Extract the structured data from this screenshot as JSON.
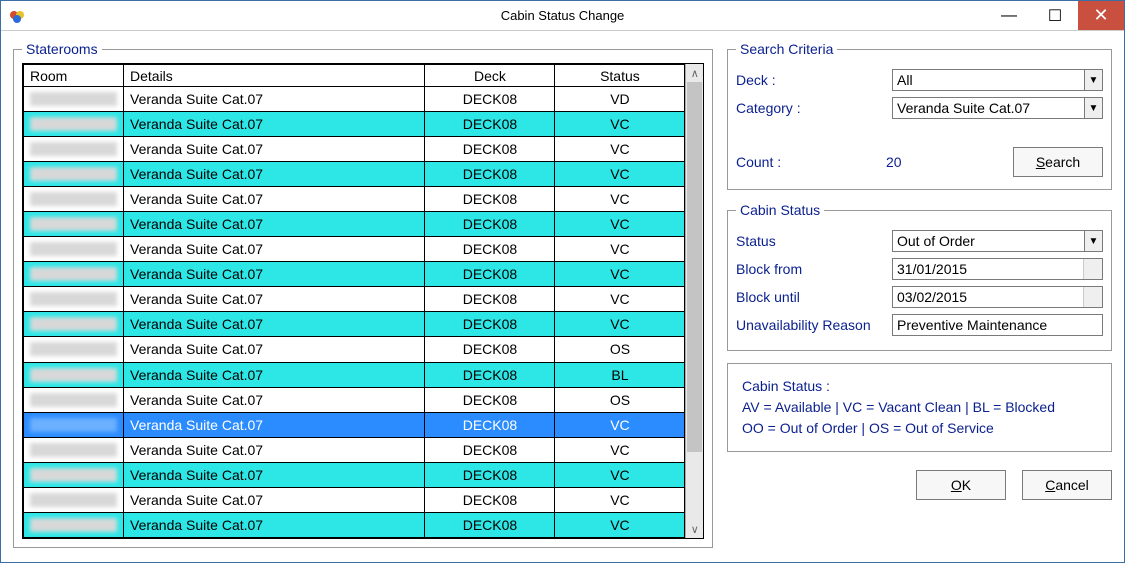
{
  "window": {
    "title": "Cabin Status Change"
  },
  "staterooms": {
    "legend": "Staterooms",
    "headers": {
      "room": "Room",
      "details": "Details",
      "deck": "Deck",
      "status": "Status"
    },
    "rows": [
      {
        "details": "Veranda Suite Cat.07",
        "deck": "DECK08",
        "status": "VD",
        "style": "white"
      },
      {
        "details": "Veranda Suite Cat.07",
        "deck": "DECK08",
        "status": "VC",
        "style": "cyan"
      },
      {
        "details": "Veranda Suite Cat.07",
        "deck": "DECK08",
        "status": "VC",
        "style": "white"
      },
      {
        "details": "Veranda Suite Cat.07",
        "deck": "DECK08",
        "status": "VC",
        "style": "cyan"
      },
      {
        "details": "Veranda Suite Cat.07",
        "deck": "DECK08",
        "status": "VC",
        "style": "white"
      },
      {
        "details": "Veranda Suite Cat.07",
        "deck": "DECK08",
        "status": "VC",
        "style": "cyan"
      },
      {
        "details": "Veranda Suite Cat.07",
        "deck": "DECK08",
        "status": "VC",
        "style": "white"
      },
      {
        "details": "Veranda Suite Cat.07",
        "deck": "DECK08",
        "status": "VC",
        "style": "cyan"
      },
      {
        "details": "Veranda Suite Cat.07",
        "deck": "DECK08",
        "status": "VC",
        "style": "white"
      },
      {
        "details": "Veranda Suite Cat.07",
        "deck": "DECK08",
        "status": "VC",
        "style": "cyan"
      },
      {
        "details": "Veranda Suite Cat.07",
        "deck": "DECK08",
        "status": "OS",
        "style": "white"
      },
      {
        "details": "Veranda Suite Cat.07",
        "deck": "DECK08",
        "status": "BL",
        "style": "cyan"
      },
      {
        "details": "Veranda Suite Cat.07",
        "deck": "DECK08",
        "status": "OS",
        "style": "white"
      },
      {
        "details": "Veranda Suite Cat.07",
        "deck": "DECK08",
        "status": "VC",
        "style": "sel"
      },
      {
        "details": "Veranda Suite Cat.07",
        "deck": "DECK08",
        "status": "VC",
        "style": "white"
      },
      {
        "details": "Veranda Suite Cat.07",
        "deck": "DECK08",
        "status": "VC",
        "style": "cyan"
      },
      {
        "details": "Veranda Suite Cat.07",
        "deck": "DECK08",
        "status": "VC",
        "style": "white"
      },
      {
        "details": "Veranda Suite Cat.07",
        "deck": "DECK08",
        "status": "VC",
        "style": "cyan"
      }
    ]
  },
  "search": {
    "legend": "Search Criteria",
    "deck_label": "Deck :",
    "deck_value": "All",
    "category_label": "Category :",
    "category_value": "Veranda Suite Cat.07",
    "count_label": "Count :",
    "count_value": "20",
    "search_btn_prefix": "S",
    "search_btn_rest": "earch"
  },
  "cabin": {
    "legend": "Cabin Status",
    "status_label": "Status",
    "status_value": "Out of Order",
    "block_from_label": "Block from",
    "block_from_value": "31/01/2015",
    "block_until_label": "Block until",
    "block_until_value": "03/02/2015",
    "reason_label": "Unavailability Reason",
    "reason_value": "Preventive Maintenance"
  },
  "legend_text": {
    "line1": "Cabin Status :",
    "line2": "AV = Available  |  VC = Vacant Clean  |  BL = Blocked",
    "line3": "OO = Out of Order  |  OS = Out of Service"
  },
  "footer": {
    "ok_ul": "O",
    "ok_rest": "K",
    "cancel_ul": "C",
    "cancel_rest": "ancel"
  }
}
